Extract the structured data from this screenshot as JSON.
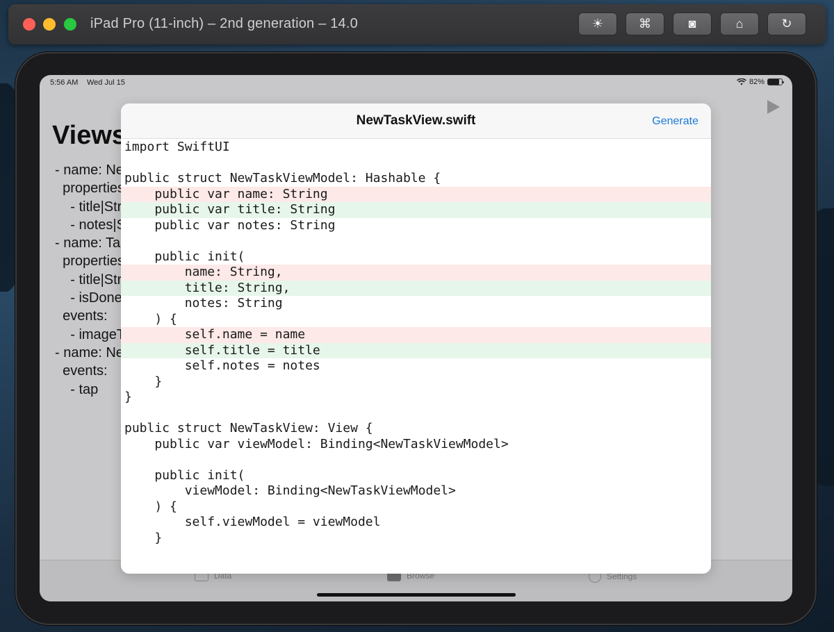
{
  "window": {
    "title": "iPad Pro (11-inch) – 2nd generation – 14.0",
    "toolbar": [
      {
        "name": "brightness-button",
        "icon": "sun-icon",
        "glyph": "☀"
      },
      {
        "name": "command-button",
        "icon": "command-icon",
        "glyph": "⌘"
      },
      {
        "name": "screenshot-button",
        "icon": "camera-icon",
        "glyph": "◙"
      },
      {
        "name": "home-button",
        "icon": "home-icon",
        "glyph": "⌂"
      },
      {
        "name": "rotate-button",
        "icon": "rotate-icon",
        "glyph": "↻"
      }
    ]
  },
  "status_bar": {
    "time": "5:56 AM",
    "date": "Wed Jul 15",
    "battery": "82%",
    "battery_level": 0.82
  },
  "background": {
    "title": "Views",
    "lines": [
      "- name: Ne",
      "  properties",
      "    - title|Str",
      "    - notes|S",
      "- name: Ta",
      "  properties",
      "    - title|Str",
      "    - isDone",
      "  events:",
      "    - imageT",
      "- name: Ne",
      "  events:",
      "    - tap"
    ]
  },
  "tab_bar": {
    "tabs": [
      {
        "label": "Data",
        "icon": "tray-icon"
      },
      {
        "label": "Browse",
        "icon": "folder-icon"
      },
      {
        "label": "Settings",
        "icon": "gear-icon"
      }
    ]
  },
  "sheet": {
    "title": "NewTaskView.swift",
    "action_label": "Generate",
    "code_lines": [
      {
        "text": "import SwiftUI",
        "diff": "none"
      },
      {
        "text": "",
        "diff": "none"
      },
      {
        "text": "public struct NewTaskViewModel: Hashable {",
        "diff": "none"
      },
      {
        "text": "    public var name: String",
        "diff": "removed"
      },
      {
        "text": "    public var title: String",
        "diff": "added"
      },
      {
        "text": "    public var notes: String",
        "diff": "none"
      },
      {
        "text": "",
        "diff": "none"
      },
      {
        "text": "    public init(",
        "diff": "none"
      },
      {
        "text": "        name: String,",
        "diff": "removed"
      },
      {
        "text": "        title: String,",
        "diff": "added"
      },
      {
        "text": "        notes: String",
        "diff": "none"
      },
      {
        "text": "    ) {",
        "diff": "none"
      },
      {
        "text": "        self.name = name",
        "diff": "removed"
      },
      {
        "text": "        self.title = title",
        "diff": "added"
      },
      {
        "text": "        self.notes = notes",
        "diff": "none"
      },
      {
        "text": "    }",
        "diff": "none"
      },
      {
        "text": "}",
        "diff": "none"
      },
      {
        "text": "",
        "diff": "none"
      },
      {
        "text": "public struct NewTaskView: View {",
        "diff": "none"
      },
      {
        "text": "    public var viewModel: Binding<NewTaskViewModel>",
        "diff": "none"
      },
      {
        "text": "",
        "diff": "none"
      },
      {
        "text": "    public init(",
        "diff": "none"
      },
      {
        "text": "        viewModel: Binding<NewTaskViewModel>",
        "diff": "none"
      },
      {
        "text": "    ) {",
        "diff": "none"
      },
      {
        "text": "        self.viewModel = viewModel",
        "diff": "none"
      },
      {
        "text": "    }",
        "diff": "none"
      }
    ]
  },
  "colors": {
    "accent": "#1a7ad6",
    "removed_bg": "#fde9e7",
    "added_bg": "#e7f6ea"
  }
}
